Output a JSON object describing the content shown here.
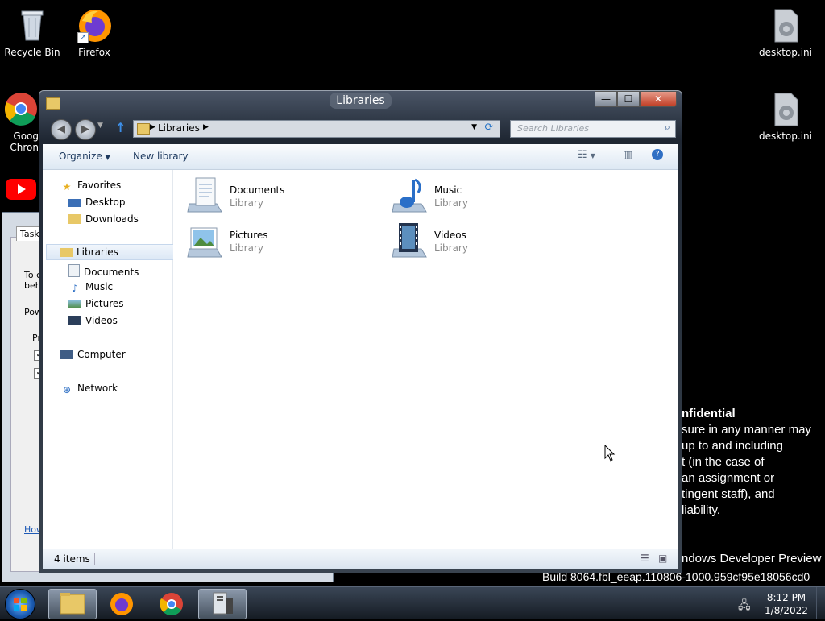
{
  "desktop": {
    "icons": [
      {
        "label": "Recycle Bin"
      },
      {
        "label": "Firefox"
      },
      {
        "label": "desktop.ini"
      },
      {
        "label": "desktop.ini"
      },
      {
        "label": "Goog\nChron"
      }
    ]
  },
  "watermark": {
    "title": "nfidential",
    "lines": [
      "sure in any manner may",
      "up to and including",
      "t (in the case of",
      "an assignment or",
      "tingent staff), and",
      "liability."
    ],
    "preview": "ndows Developer Preview",
    "build": "Build 8064.fbl_eeap.110806-1000.959cf95e18056cd0"
  },
  "bg_dialog": {
    "tab": "Taskb",
    "text1": "To c",
    "text2": "beh",
    "text3": "Pow",
    "text4": "Pr",
    "link": "How"
  },
  "window": {
    "title": "Libraries",
    "controls": {
      "minimize": "—",
      "maximize": "☐",
      "close": "✕"
    },
    "address": {
      "crumb": "Libraries"
    },
    "search": {
      "placeholder": "Search Libraries"
    },
    "commands": {
      "organize": "Organize",
      "new_library": "New library"
    },
    "nav": {
      "favorites": "Favorites",
      "desktop": "Desktop",
      "downloads": "Downloads",
      "libraries": "Libraries",
      "documents": "Documents",
      "music": "Music",
      "pictures": "Pictures",
      "videos": "Videos",
      "computer": "Computer",
      "network": "Network"
    },
    "items": [
      {
        "name": "Documents",
        "type": "Library"
      },
      {
        "name": "Music",
        "type": "Library"
      },
      {
        "name": "Pictures",
        "type": "Library"
      },
      {
        "name": "Videos",
        "type": "Library"
      }
    ],
    "status": {
      "count": "4 items"
    }
  },
  "taskbar": {
    "time": "8:12 PM",
    "date": "1/8/2022"
  },
  "colors": {
    "desktop_bg": "#000000",
    "selection": "#dce8f5",
    "link_blue": "#1e5ab6"
  }
}
